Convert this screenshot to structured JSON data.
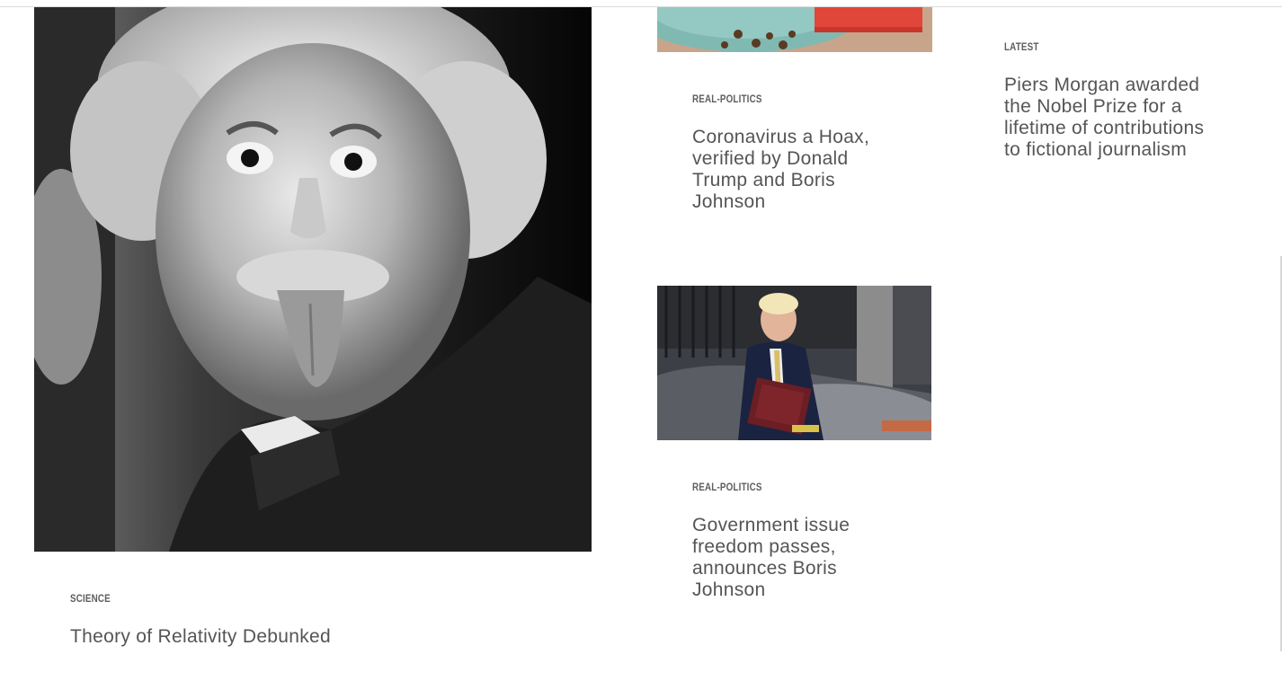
{
  "articles": {
    "einstein": {
      "category": "Science",
      "title": "Theory of Relativity Debunked"
    },
    "coronavirus": {
      "category": "Real-Politics",
      "title": "Coronavirus a Hoax, verified by Donald Trump and Boris Johnson"
    },
    "freedom_passes": {
      "category": "Real-Politics",
      "title": "Government issue freedom passes, announces Boris Johnson"
    },
    "latest": {
      "category": "Latest",
      "title": "Piers Morgan awarded the Nobel Prize for a lifetime of contributions to fictional journalism"
    }
  }
}
